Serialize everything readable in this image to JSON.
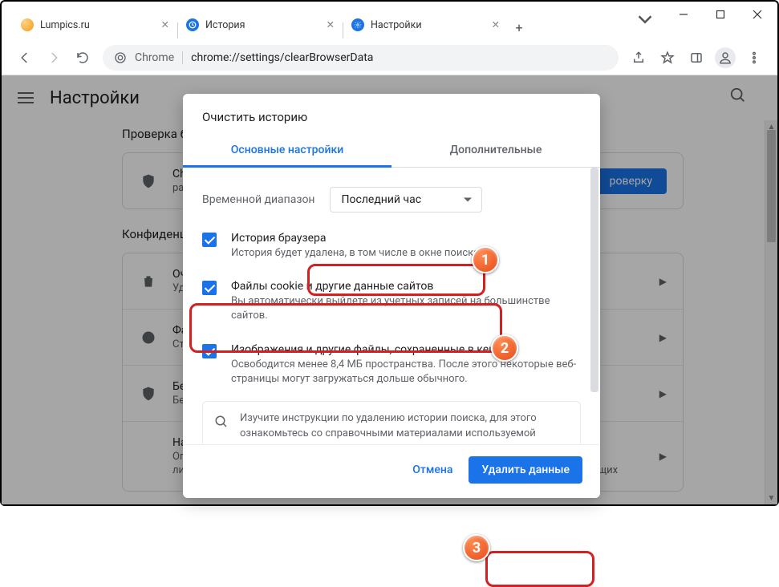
{
  "window": {
    "tabs": [
      {
        "title": "Lumpics.ru",
        "active": false,
        "favicon": "lumpics"
      },
      {
        "title": "История",
        "active": false,
        "favicon": "history"
      },
      {
        "title": "Настройки",
        "active": true,
        "favicon": "settings"
      }
    ]
  },
  "addressbar": {
    "prefix": "Chrome",
    "url": "chrome://settings/clearBrowserData"
  },
  "page": {
    "title": "Настройки",
    "section_check": "Проверка бе",
    "check_row_title": "Chro",
    "check_row_sub": "расш",
    "check_button": "роверку",
    "section_privacy": "Конфиденци",
    "rows": [
      {
        "title": "Очис",
        "sub": "Удал"
      },
      {
        "title": "Файл",
        "sub": "Стор"
      },
      {
        "title": "Безо",
        "sub": "Безо"
      },
      {
        "title": "Настр",
        "sub": "Опре",
        "sub2": "ли у них доступ к местоположению и камере, а также разрешение на показ всплывающих"
      }
    ]
  },
  "modal": {
    "title": "Очистить историю",
    "tabs": {
      "basic": "Основные настройки",
      "advanced": "Дополнительные"
    },
    "time_label": "Временной диапазон",
    "time_value": "Последний час",
    "checks": [
      {
        "title": "История браузера",
        "sub": "История будет удалена, в том числе в окне поиска"
      },
      {
        "title": "Файлы cookie и другие данные сайтов",
        "sub": "Вы автоматически выйдете из учетных записей на большинстве сайтов."
      },
      {
        "title": "Изображения и другие файлы, сохраненные в кеше",
        "sub": "Освободится менее 8,4 МБ пространства. После этого некоторые веб-страницы могут загружаться дольше обычного."
      }
    ],
    "tip": "Изучите инструкции по удалению истории поиска, для этого ознакомьтесь со справочными материалами используемой",
    "cancel": "Отмена",
    "confirm": "Удалить данные"
  },
  "annotations": {
    "b1": "1",
    "b2": "2",
    "b3": "3"
  }
}
